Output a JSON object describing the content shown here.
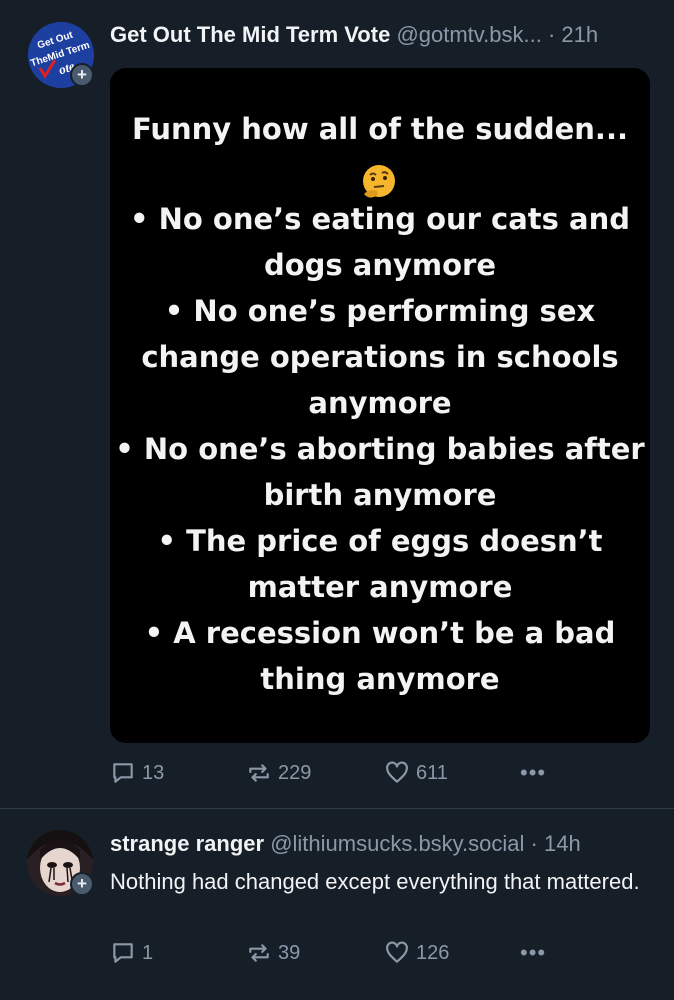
{
  "posts": [
    {
      "author_name": "Get Out The Mid Term Vote",
      "handle": "@gotmtv.bsk...",
      "separator": "·",
      "time": "21h",
      "avatar_text": [
        "Get Out",
        "TheMid Term",
        "ote"
      ],
      "image_text": [
        "Funny how all of the sudden...",
        "• No one’s eating our cats and",
        "dogs anymore",
        "• No one’s performing sex",
        "change operations in schools",
        "anymore",
        "• No one’s aborting babies after",
        "birth anymore",
        "• The price of eggs doesn’t",
        "matter anymore",
        "• A recession won’t be a bad",
        "thing anymore"
      ],
      "image_emoji": "thinking-face-emoji",
      "counts": {
        "replies": "13",
        "reposts": "229",
        "likes": "611"
      },
      "more_label": "•••"
    },
    {
      "author_name": "strange ranger",
      "handle": "@lithiumsucks.bsky.social",
      "separator": "·",
      "time": "14h",
      "text": "Nothing had changed except everything that mattered.",
      "counts": {
        "replies": "1",
        "reposts": "39",
        "likes": "126"
      },
      "more_label": "•••"
    }
  ],
  "follow_badge": "+",
  "icons": {
    "reply": "speech-bubble-icon",
    "repost": "repost-arrows-icon",
    "like": "heart-icon",
    "more": "ellipsis-icon"
  },
  "colors": {
    "background": "#161e27",
    "muted": "#8b98a8",
    "text": "#f1f3f5",
    "divider": "#2e3a48"
  }
}
